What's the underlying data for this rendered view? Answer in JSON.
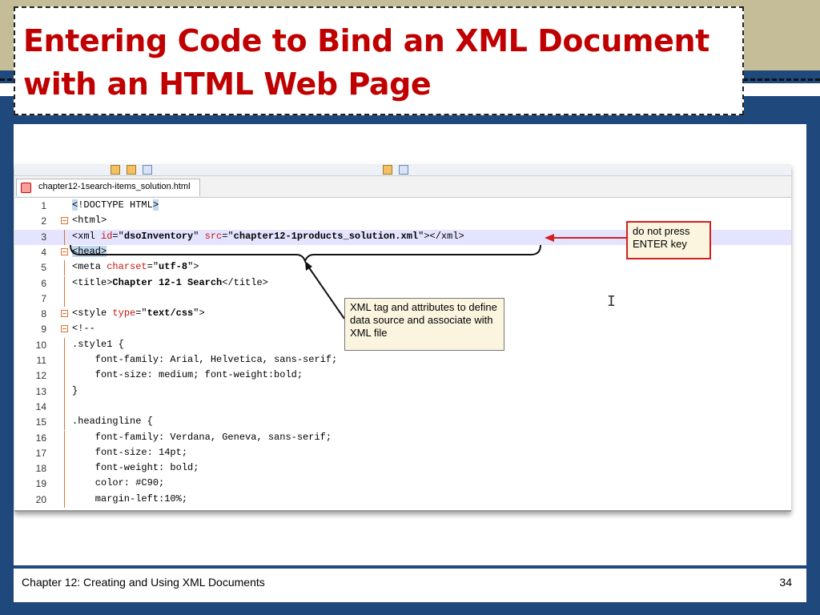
{
  "slide": {
    "title_line1": "Entering Code to Bind an XML Document",
    "title_line2": "with an HTML Web Page",
    "footer": "Chapter 12: Creating and Using XML Documents",
    "page_number": "34"
  },
  "editor": {
    "tab_label": "chapter12-1search-items_solution.html",
    "lines": [
      {
        "n": "1",
        "parts": [
          [
            "sel",
            "<"
          ],
          [
            "",
            "!DOCTYPE HTML"
          ],
          [
            "sel",
            ">"
          ]
        ]
      },
      {
        "n": "2",
        "parts": [
          [
            "tag",
            "<html>"
          ]
        ]
      },
      {
        "n": "3",
        "parts": [
          [
            "",
            "<xml "
          ],
          [
            "attr",
            "id"
          ],
          [
            "",
            "=\""
          ],
          [
            "val",
            "dsoInventory"
          ],
          [
            "",
            "\" "
          ],
          [
            "attr",
            "src"
          ],
          [
            "",
            "=\""
          ],
          [
            "val",
            "chapter12-1products_solution.xml"
          ],
          [
            "",
            "\"></xml>"
          ]
        ]
      },
      {
        "n": "4",
        "parts": [
          [
            "sel",
            "<head>"
          ]
        ]
      },
      {
        "n": "5",
        "parts": [
          [
            "",
            "<meta "
          ],
          [
            "attr",
            "charset"
          ],
          [
            "",
            "=\""
          ],
          [
            "val",
            "utf-8"
          ],
          [
            "",
            "\">"
          ]
        ]
      },
      {
        "n": "6",
        "parts": [
          [
            "",
            "<title>"
          ],
          [
            "val",
            "Chapter 12-1 Search"
          ],
          [
            "",
            "</title>"
          ]
        ]
      },
      {
        "n": "7",
        "parts": []
      },
      {
        "n": "8",
        "parts": [
          [
            "",
            "<style "
          ],
          [
            "attr",
            "type"
          ],
          [
            "",
            "=\""
          ],
          [
            "val",
            "text/css"
          ],
          [
            "",
            "\">"
          ]
        ]
      },
      {
        "n": "9",
        "parts": [
          [
            "",
            "<!--"
          ]
        ]
      },
      {
        "n": "10",
        "parts": [
          [
            "",
            ".style1 {"
          ]
        ]
      },
      {
        "n": "11",
        "parts": [
          [
            "",
            "    font-family: Arial, Helvetica, sans-serif;"
          ]
        ]
      },
      {
        "n": "12",
        "parts": [
          [
            "",
            "    font-size: medium; font-weight:bold;"
          ]
        ]
      },
      {
        "n": "13",
        "parts": [
          [
            "",
            "}"
          ]
        ]
      },
      {
        "n": "14",
        "parts": []
      },
      {
        "n": "15",
        "parts": [
          [
            "",
            ".headingline {"
          ]
        ]
      },
      {
        "n": "16",
        "parts": [
          [
            "",
            "    font-family: Verdana, Geneva, sans-serif;"
          ]
        ]
      },
      {
        "n": "17",
        "parts": [
          [
            "",
            "    font-size: 14pt;"
          ]
        ]
      },
      {
        "n": "18",
        "parts": [
          [
            "",
            "    font-weight: bold;"
          ]
        ]
      },
      {
        "n": "19",
        "parts": [
          [
            "",
            "    color: #C90;"
          ]
        ]
      },
      {
        "n": "20",
        "parts": [
          [
            "",
            "    margin-left:10%;"
          ]
        ]
      }
    ],
    "highlighted_line": "3",
    "fold_lines": [
      "2",
      "4",
      "8",
      "9"
    ]
  },
  "callouts": {
    "enter_key": "do not press ENTER key",
    "xml_tag": "XML tag and attributes to define data source and associate with XML file"
  },
  "colors": {
    "title": "#c00000",
    "background": "#1f497d",
    "band": "#c4bd97",
    "arrow_red": "#d02020"
  }
}
